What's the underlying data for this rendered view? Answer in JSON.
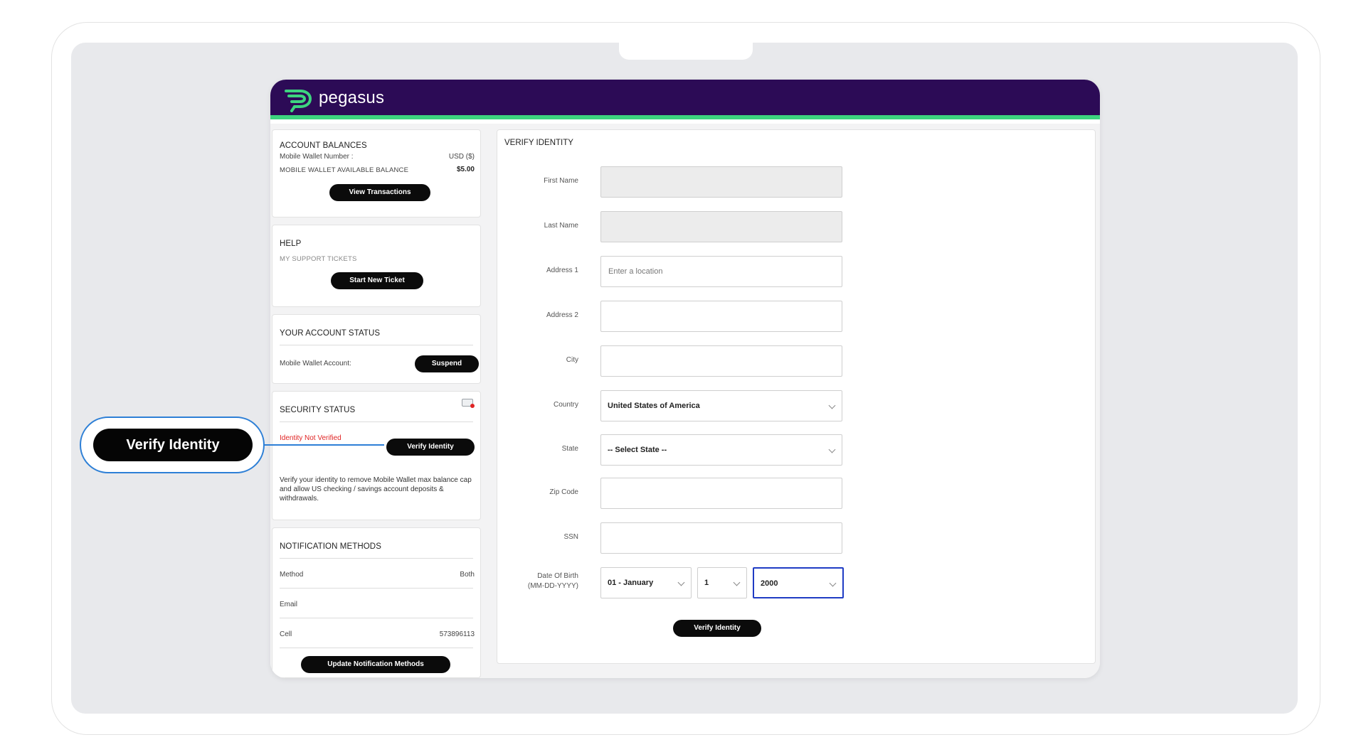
{
  "app": {
    "brand": "pegasus",
    "brand_color": "#2c0b56",
    "accent": "#3dd47f",
    "logo_icon": "pegasus-logo-icon"
  },
  "account_balances": {
    "title": "ACCOUNT BALANCES",
    "wallet_number_label": "Mobile Wallet Number :",
    "currency": "USD ($)",
    "available_label": "MOBILE WALLET AVAILABLE BALANCE",
    "available_value": "$5.00",
    "view_button": "View Transactions"
  },
  "help": {
    "title": "HELP",
    "tickets_label": "MY SUPPORT TICKETS",
    "start_button": "Start New Ticket"
  },
  "account_status": {
    "title": "YOUR ACCOUNT STATUS",
    "wallet_label": "Mobile Wallet Account:",
    "suspend_button": "Suspend"
  },
  "security": {
    "title": "SECURITY STATUS",
    "icon": "id-card-icon",
    "status": "Identity Not Verified",
    "verify_button": "Verify Identity",
    "description": "Verify your identity to remove Mobile Wallet max balance cap and allow US checking / savings account deposits & withdrawals."
  },
  "notifications": {
    "title": "NOTIFICATION METHODS",
    "rows": [
      {
        "label": "Method",
        "value": "Both"
      },
      {
        "label": "Email",
        "value": ""
      },
      {
        "label": "Cell",
        "value": "573896113"
      }
    ],
    "update_button": "Update Notification Methods"
  },
  "verify_form": {
    "title": "VERIFY IDENTITY",
    "first_name_label": "First Name",
    "last_name_label": "Last Name",
    "address1_label": "Address 1",
    "address1_placeholder": "Enter a location",
    "address2_label": "Address 2",
    "city_label": "City",
    "country_label": "Country",
    "country_value": "United States of America",
    "state_label": "State",
    "state_value": "-- Select State --",
    "zip_label": "Zip Code",
    "ssn_label": "SSN",
    "dob_label": "Date Of Birth",
    "dob_format": "(MM-DD-YYYY)",
    "dob_month": "01 - January",
    "dob_day": "1",
    "dob_year": "2000",
    "submit_button": "Verify Identity"
  },
  "callout": {
    "label": "Verify Identity",
    "color": "#2d7fd6"
  }
}
